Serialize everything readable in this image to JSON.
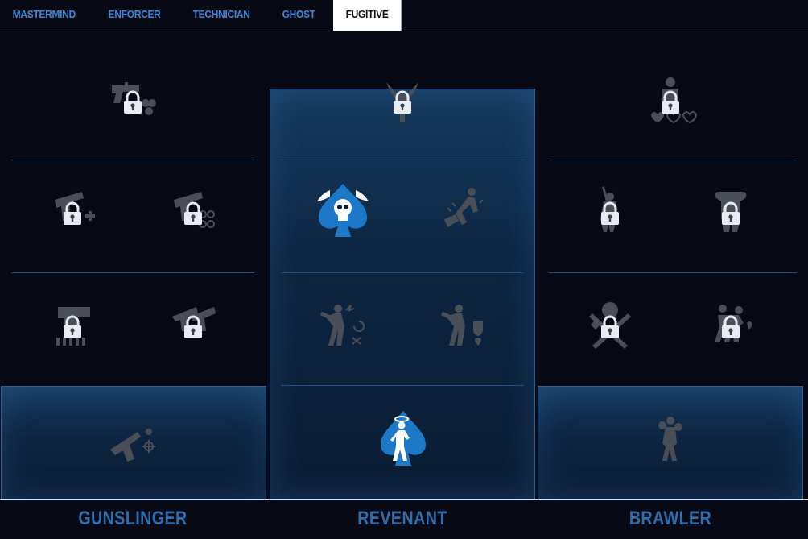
{
  "tabs": [
    {
      "label": "MASTERMIND",
      "active": false
    },
    {
      "label": "ENFORCER",
      "active": false
    },
    {
      "label": "TECHNICIAN",
      "active": false
    },
    {
      "label": "GHOST",
      "active": false
    },
    {
      "label": "FUGITIVE",
      "active": true
    }
  ],
  "trees": [
    {
      "title": "GUNSLINGER",
      "highlighted_tier": "base",
      "skills": [
        {
          "icon": "revolver-skulls-icon",
          "locked": true
        },
        {
          "icon": "pistol-plus-icon",
          "locked": true
        },
        {
          "icon": "pistol-targets-icon",
          "locked": true
        },
        {
          "icon": "pistol-ammo-icon",
          "locked": true
        },
        {
          "icon": "dual-pistols-icon",
          "locked": true
        },
        {
          "icon": "revolver-crosshair-icon",
          "locked": false
        }
      ]
    },
    {
      "title": "REVENANT",
      "highlighted_tier": "all",
      "skills": [
        {
          "icon": "winged-ace-icon",
          "locked": true
        },
        {
          "icon": "winged-skull-spade-icon",
          "locked": false,
          "owned": true
        },
        {
          "icon": "falling-figure-icon",
          "locked": false
        },
        {
          "icon": "electrified-figure-swap-icon",
          "locked": false
        },
        {
          "icon": "electrified-figure-health-icon",
          "locked": false
        },
        {
          "icon": "haloed-spade-figure-icon",
          "locked": false,
          "owned": true
        }
      ]
    },
    {
      "title": "BRAWLER",
      "highlighted_tier": "base",
      "skills": [
        {
          "icon": "fighter-hearts-icon",
          "locked": true
        },
        {
          "icon": "baton-figure-icon",
          "locked": true
        },
        {
          "icon": "strongman-icon",
          "locked": true
        },
        {
          "icon": "skull-crossed-axes-icon",
          "locked": true
        },
        {
          "icon": "grappling-figures-icon",
          "locked": true
        },
        {
          "icon": "boxer-icon",
          "locked": false
        }
      ]
    }
  ],
  "colors": {
    "accent": "#2b6fb0",
    "tab_text": "#3f86d6",
    "owned_icon": "#1e78c8",
    "inactive_icon": "#4a4e57"
  }
}
